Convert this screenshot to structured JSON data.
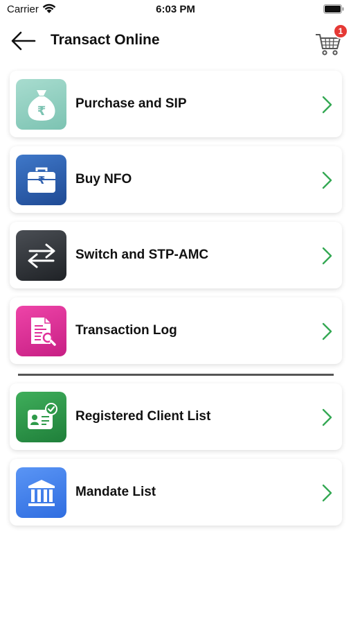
{
  "status_bar": {
    "carrier": "Carrier",
    "time": "6:03 PM"
  },
  "header": {
    "title": "Transact Online",
    "back_icon": "arrow-left-icon",
    "cart_icon": "shopping-cart-icon",
    "cart_count": "1"
  },
  "colors": {
    "chevron": "#34a853",
    "badge": "#e53935",
    "purchase_tile": "#8fcfc0",
    "nfo_tile": "#2e5fae",
    "switch_tile": "#33373c",
    "log_tile": "#e0309a",
    "client_tile": "#2e9a49",
    "mandate_tile": "#3f7ff0"
  },
  "menu": {
    "group_one": [
      {
        "label": "Purchase and SIP",
        "icon": "money-bag-rupee-icon"
      },
      {
        "label": "Buy NFO",
        "icon": "briefcase-rupee-icon"
      },
      {
        "label": "Switch and STP-AMC",
        "icon": "swap-arrows-icon"
      },
      {
        "label": "Transaction Log",
        "icon": "document-search-icon"
      }
    ],
    "group_two": [
      {
        "label": "Registered Client List",
        "icon": "id-card-check-icon"
      },
      {
        "label": "Mandate List",
        "icon": "bank-building-icon"
      }
    ]
  }
}
